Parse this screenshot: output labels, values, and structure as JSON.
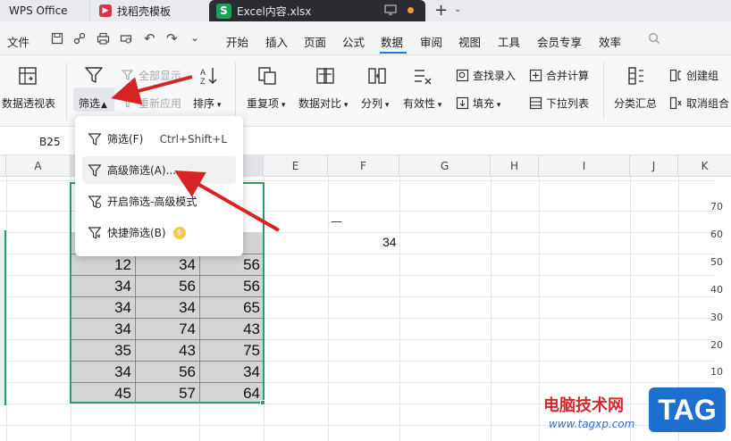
{
  "tabs": {
    "wps": "WPS Office",
    "docer": "找稻壳模板",
    "excel": "Excel内容.xlsx"
  },
  "menu": {
    "file": "文件",
    "items": [
      "开始",
      "插入",
      "页面",
      "公式",
      "数据",
      "审阅",
      "视图",
      "工具",
      "会员专享",
      "效率"
    ]
  },
  "ribbon": {
    "pivot": "数据透视表",
    "filter": "筛选",
    "show_all": "全部显示",
    "reapply": "重新应用",
    "sort": "排序",
    "duplicates": "重复项",
    "compare": "数据对比",
    "split": "分列",
    "validity": "有效性",
    "find_entry": "查找录入",
    "fill": "填充",
    "merge_calc": "合并计算",
    "dropdown_list": "下拉列表",
    "subtotal": "分类汇总",
    "create_group": "创建组",
    "ungroup": "取消组合"
  },
  "formula_bar": {
    "cell_ref": "B25"
  },
  "columns": [
    "A",
    "B",
    "C",
    "D",
    "E",
    "F",
    "G",
    "H",
    "I",
    "J",
    "K"
  ],
  "dropdown": {
    "items": [
      {
        "label": "筛选(F)",
        "shortcut": "Ctrl+Shift+L"
      },
      {
        "label": "高级筛选(A)..."
      },
      {
        "label": "开启筛选-高级模式"
      },
      {
        "label": "快捷筛选(B)"
      }
    ]
  },
  "sheet": {
    "f_value": "34",
    "rows": [
      [
        "12",
        "34",
        "56"
      ],
      [
        "34",
        "56",
        "56"
      ],
      [
        "34",
        "34",
        "65"
      ],
      [
        "34",
        "74",
        "43"
      ],
      [
        "35",
        "43",
        "75"
      ],
      [
        "34",
        "56",
        "34"
      ],
      [
        "45",
        "57",
        "64"
      ]
    ]
  },
  "axis_labels": [
    "70",
    "60",
    "50",
    "40",
    "30",
    "20",
    "10"
  ],
  "watermark": {
    "site_name": "电脑技术网",
    "site_url": "www.tagxp.com",
    "badge": "TAG"
  }
}
